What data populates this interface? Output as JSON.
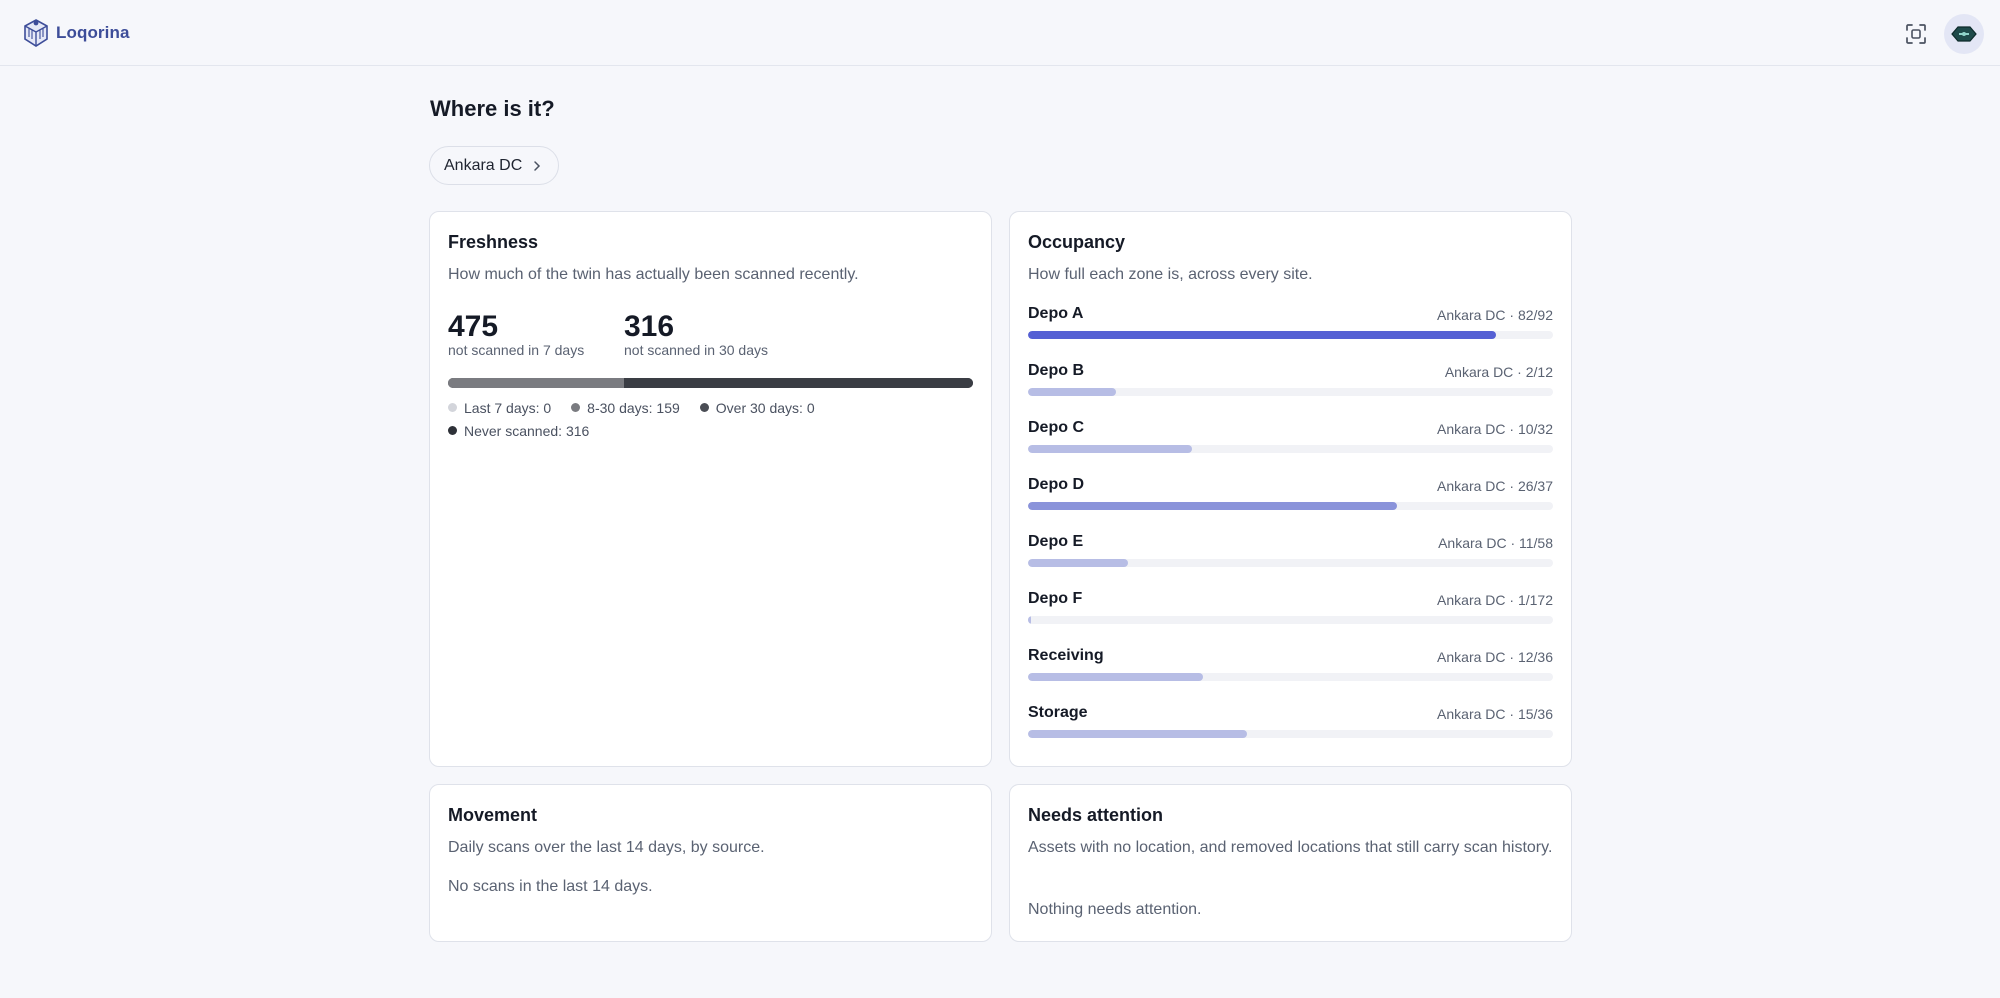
{
  "app": {
    "name": "Loqorina"
  },
  "page": {
    "title": "Where is it?",
    "site": "Ankara DC"
  },
  "freshness": {
    "title": "Freshness",
    "subtitle": "How much of the twin has actually been scanned recently.",
    "stat1": {
      "value": "475",
      "label": "not scanned in 7 days"
    },
    "stat2": {
      "value": "316",
      "label": "not scanned in 30 days"
    },
    "bar": [
      {
        "label": "8-30 days",
        "value": 159,
        "color": "#7a7b80"
      },
      {
        "label": "Never scanned",
        "value": 316,
        "color": "#3a3d44"
      }
    ],
    "legend": [
      {
        "text": "Last 7 days: 0",
        "color": "#d3d5db"
      },
      {
        "text": "8-30 days: 159",
        "color": "#7a7b80"
      },
      {
        "text": "Over 30 days: 0",
        "color": "#4a4d55"
      },
      {
        "text": "Never scanned: 316",
        "color": "#2e3138"
      }
    ]
  },
  "occupancy": {
    "title": "Occupancy",
    "subtitle": "How full each zone is, across every site.",
    "zones": [
      {
        "name": "Depo A",
        "meta": "Ankara DC · 82/92",
        "used": 82,
        "capacity": 92,
        "color": "#5560d4"
      },
      {
        "name": "Depo B",
        "meta": "Ankara DC · 2/12",
        "used": 2,
        "capacity": 12,
        "color": "#b7bde5"
      },
      {
        "name": "Depo C",
        "meta": "Ankara DC · 10/32",
        "used": 10,
        "capacity": 32,
        "color": "#b7bde5"
      },
      {
        "name": "Depo D",
        "meta": "Ankara DC · 26/37",
        "used": 26,
        "capacity": 37,
        "color": "#8a93da"
      },
      {
        "name": "Depo E",
        "meta": "Ankara DC · 11/58",
        "used": 11,
        "capacity": 58,
        "color": "#b7bde5"
      },
      {
        "name": "Depo F",
        "meta": "Ankara DC · 1/172",
        "used": 1,
        "capacity": 172,
        "color": "#b7bde5"
      },
      {
        "name": "Receiving",
        "meta": "Ankara DC · 12/36",
        "used": 12,
        "capacity": 36,
        "color": "#b7bde5"
      },
      {
        "name": "Storage",
        "meta": "Ankara DC · 15/36",
        "used": 15,
        "capacity": 36,
        "color": "#b7bde5"
      }
    ]
  },
  "movement": {
    "title": "Movement",
    "subtitle": "Daily scans over the last 14 days, by source.",
    "empty": "No scans in the last 14 days."
  },
  "attention": {
    "title": "Needs attention",
    "subtitle": "Assets with no location, and removed locations that still carry scan history.",
    "empty": "Nothing needs attention."
  }
}
